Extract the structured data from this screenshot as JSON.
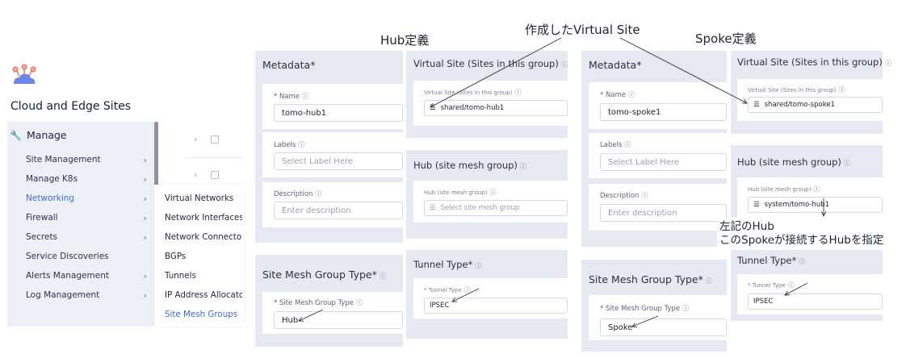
{
  "titles": {
    "hub": "Hub定義",
    "virtual_site": "作成したVirtual Site",
    "spoke": "Spoke定義"
  },
  "annotation": {
    "line1": "左記のHub",
    "line2": "このSpokeが接続するHubを指定"
  },
  "sidebar": {
    "app_title": "Cloud and Edge Sites",
    "section": "Manage",
    "items": [
      {
        "label": "Site Management",
        "chevron": "›"
      },
      {
        "label": "Manage K8s",
        "chevron": "›"
      },
      {
        "label": "Networking",
        "chevron": "›"
      },
      {
        "label": "Firewall",
        "chevron": "›"
      },
      {
        "label": "Secrets",
        "chevron": "›"
      },
      {
        "label": "Service Discoveries",
        "chevron": ""
      },
      {
        "label": "Alerts Management",
        "chevron": "›"
      },
      {
        "label": "Log Management",
        "chevron": "›"
      }
    ],
    "submenu": [
      "Virtual Networks",
      "Network Interfaces",
      "Network Connectors",
      "BGPs",
      "Tunnels",
      "IP Address Allocators",
      "Site Mesh Groups"
    ]
  },
  "hub_form": {
    "metadata_title": "Metadata",
    "required_mark": "*",
    "name_label": "* Name",
    "name_value": "tomo-hub1",
    "labels_label": "Labels",
    "labels_placeholder": "Select Label Here",
    "description_label": "Description",
    "description_placeholder": "Enter description",
    "smg_type_title": "Site Mesh Group Type",
    "smg_type_label": "* Site Mesh Group Type",
    "smg_type_value": "Hub",
    "virtual_site_title": "Virtual Site (Sites in this group)",
    "virtual_site_label": "Virtual Site (Sites in this group)",
    "virtual_site_value": "shared/tomo-hub1",
    "hub_title": "Hub (site mesh group)",
    "hub_label": "Hub (site mesh group)",
    "hub_placeholder": "Select site mesh group",
    "tunnel_title": "Tunnel Type",
    "tunnel_label": "* Tunnel Type",
    "tunnel_value": "IPSEC"
  },
  "spoke_form": {
    "metadata_title": "Metadata",
    "required_mark": "*",
    "name_label": "* Name",
    "name_value": "tomo-spoke1",
    "labels_label": "Labels",
    "labels_placeholder": "Select Label Here",
    "description_label": "Description",
    "description_placeholder": "Enter description",
    "smg_type_title": "Site Mesh Group Type",
    "smg_type_label": "* Site Mesh Group Type",
    "smg_type_value": "Spoke",
    "virtual_site_title": "Virtual Site (Sites in this group)",
    "virtual_site_label": "Virtual Site (Sites in this group)",
    "virtual_site_value": "shared/tomo-spoke1",
    "hub_title": "Hub (site mesh group)",
    "hub_label": "Hub (site mesh group)",
    "hub_value": "system/tomo-hub1",
    "tunnel_title": "Tunnel Type",
    "tunnel_label": "* Tunnel Type",
    "tunnel_value": "IPSEC"
  },
  "icons": {
    "help": "?-circle",
    "list": "list-icon"
  },
  "colors": {
    "accent": "#3b6dd8",
    "panel": "#e7e9f2",
    "nav": "#eef0f7"
  }
}
